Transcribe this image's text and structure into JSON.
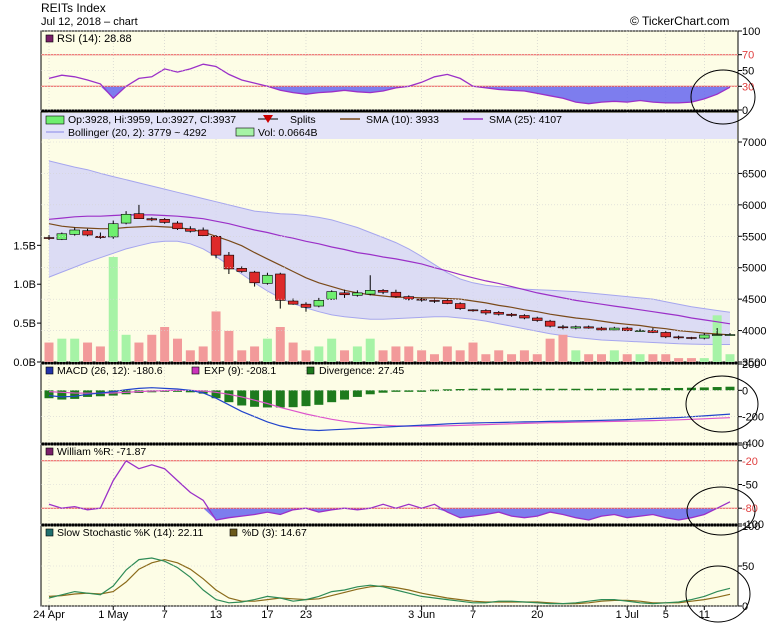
{
  "header": {
    "title": "REITs Index",
    "date": "Jul 12, 2018",
    "separator": "–",
    "chart_word": "chart",
    "watermark": "© TickerChart.com"
  },
  "colors": {
    "panel_bg": "#fdfde6",
    "rsi_line": "#9b30c8",
    "rsi_fill": "#6666ee",
    "ref_line": "#ee5555",
    "candle_up": "#6fef6f",
    "candle_down": "#dd2a2a",
    "sma10": "#7a4a1a",
    "sma25": "#9b30c8",
    "bollinger_line": "#a6a6ee",
    "bollinger_fill": "#d3d3f7",
    "vol_up": "#a6f3a6",
    "vol_down": "#f29a9a",
    "macd": "#2244cc",
    "exp": "#dd55cc",
    "divergence": "#1d7a1d",
    "william": "#9b30c8",
    "stoch_k": "#2e8b57",
    "stoch_d": "#8b6b1a"
  },
  "chart_data": {
    "type": "candlestick",
    "x_ticks": [
      {
        "i": 0,
        "label": "24 Apr"
      },
      {
        "i": 5,
        "label": "1 May"
      },
      {
        "i": 9,
        "label": "7"
      },
      {
        "i": 13,
        "label": "13"
      },
      {
        "i": 17,
        "label": "17"
      },
      {
        "i": 20,
        "label": "23"
      },
      {
        "i": 29,
        "label": "3 Jun"
      },
      {
        "i": 33,
        "label": "7"
      },
      {
        "i": 38,
        "label": "20"
      },
      {
        "i": 45,
        "label": "1 Jul"
      },
      {
        "i": 48,
        "label": "5"
      },
      {
        "i": 51,
        "label": "11"
      }
    ],
    "price": {
      "legend": {
        "ohlc": "Op:3928, Hi:3959, Lo:3927, Cl:3937",
        "splits": "Splits",
        "sma10": "SMA (10): 3933",
        "sma25": "SMA (25): 4107",
        "bollinger": "Bollinger (20, 2): 3779 ~ 4292",
        "volume": "Vol: 0.0664B"
      },
      "ylim": [
        3500,
        7000
      ],
      "y_ticks": [
        3500,
        4000,
        4500,
        5000,
        5500,
        6000,
        6500,
        7000
      ],
      "y_tick_labels": [
        "3500",
        "4000",
        "4500",
        "5000",
        "5500",
        "6000",
        "6500",
        "7000"
      ],
      "candles": [
        [
          5480,
          5520,
          5440,
          5470
        ],
        [
          5450,
          5560,
          5440,
          5540
        ],
        [
          5530,
          5640,
          5510,
          5600
        ],
        [
          5590,
          5620,
          5500,
          5520
        ],
        [
          5500,
          5560,
          5460,
          5480
        ],
        [
          5490,
          5750,
          5460,
          5700
        ],
        [
          5710,
          5900,
          5690,
          5850
        ],
        [
          5860,
          6000,
          5820,
          5780
        ],
        [
          5780,
          5800,
          5740,
          5760
        ],
        [
          5770,
          5790,
          5700,
          5720
        ],
        [
          5710,
          5740,
          5600,
          5620
        ],
        [
          5620,
          5660,
          5560,
          5580
        ],
        [
          5600,
          5640,
          5500,
          5510
        ],
        [
          5500,
          5520,
          5150,
          5200
        ],
        [
          5200,
          5250,
          4900,
          4980
        ],
        [
          4990,
          5020,
          4920,
          4940
        ],
        [
          4930,
          4950,
          4700,
          4760
        ],
        [
          4750,
          4920,
          4730,
          4880
        ],
        [
          4900,
          4920,
          4350,
          4480
        ],
        [
          4470,
          4510,
          4410,
          4420
        ],
        [
          4420,
          4450,
          4300,
          4370
        ],
        [
          4390,
          4520,
          4370,
          4480
        ],
        [
          4500,
          4640,
          4490,
          4620
        ],
        [
          4600,
          4650,
          4520,
          4570
        ],
        [
          4560,
          4640,
          4540,
          4600
        ],
        [
          4580,
          4880,
          4560,
          4640
        ],
        [
          4640,
          4660,
          4580,
          4610
        ],
        [
          4610,
          4650,
          4520,
          4540
        ],
        [
          4540,
          4560,
          4480,
          4500
        ],
        [
          4500,
          4520,
          4460,
          4490
        ],
        [
          4480,
          4510,
          4440,
          4470
        ],
        [
          4480,
          4500,
          4420,
          4430
        ],
        [
          4430,
          4450,
          4330,
          4350
        ],
        [
          4330,
          4340,
          4300,
          4320
        ],
        [
          4320,
          4340,
          4250,
          4280
        ],
        [
          4290,
          4310,
          4240,
          4260
        ],
        [
          4260,
          4280,
          4220,
          4240
        ],
        [
          4240,
          4260,
          4180,
          4200
        ],
        [
          4200,
          4220,
          4140,
          4160
        ],
        [
          4150,
          4170,
          4050,
          4070
        ],
        [
          4060,
          4090,
          4020,
          4050
        ],
        [
          4040,
          4080,
          4020,
          4060
        ],
        [
          4060,
          4080,
          4030,
          4040
        ],
        [
          4040,
          4060,
          4000,
          4010
        ],
        [
          4010,
          4060,
          4000,
          4040
        ],
        [
          4040,
          4060,
          3990,
          4000
        ],
        [
          4000,
          4030,
          3980,
          4000
        ],
        [
          4000,
          4040,
          3960,
          3970
        ],
        [
          3970,
          3990,
          3880,
          3900
        ],
        [
          3900,
          3920,
          3860,
          3890
        ],
        [
          3890,
          3900,
          3860,
          3880
        ],
        [
          3880,
          3960,
          3860,
          3930
        ],
        [
          3928,
          4040,
          3927,
          3937
        ],
        [
          3937,
          3959,
          3927,
          3937
        ]
      ],
      "sma10": [
        5700,
        5660,
        5640,
        5630,
        5620,
        5620,
        5640,
        5650,
        5660,
        5650,
        5640,
        5610,
        5570,
        5500,
        5430,
        5350,
        5240,
        5140,
        5040,
        4940,
        4840,
        4760,
        4700,
        4640,
        4600,
        4570,
        4550,
        4530,
        4530,
        4520,
        4520,
        4510,
        4500,
        4470,
        4440,
        4400,
        4370,
        4330,
        4300,
        4260,
        4230,
        4200,
        4180,
        4150,
        4120,
        4100,
        4080,
        4050,
        4030,
        4000,
        3980,
        3960,
        3945,
        3933
      ],
      "sma25": [
        5770,
        5790,
        5810,
        5820,
        5820,
        5830,
        5840,
        5840,
        5840,
        5830,
        5820,
        5800,
        5780,
        5740,
        5700,
        5650,
        5600,
        5560,
        5510,
        5470,
        5420,
        5380,
        5330,
        5290,
        5240,
        5210,
        5170,
        5140,
        5100,
        5060,
        5000,
        4950,
        4890,
        4840,
        4790,
        4750,
        4700,
        4650,
        4600,
        4560,
        4520,
        4480,
        4450,
        4420,
        4390,
        4360,
        4330,
        4300,
        4270,
        4240,
        4200,
        4170,
        4140,
        4107
      ],
      "bollinger_upper": [
        6700,
        6650,
        6600,
        6560,
        6500,
        6450,
        6400,
        6350,
        6300,
        6250,
        6200,
        6150,
        6100,
        6050,
        6000,
        5950,
        5900,
        5880,
        5860,
        5850,
        5830,
        5800,
        5760,
        5700,
        5640,
        5560,
        5480,
        5400,
        5300,
        5180,
        5050,
        4920,
        4820,
        4760,
        4720,
        4700,
        4680,
        4660,
        4650,
        4640,
        4630,
        4620,
        4600,
        4580,
        4560,
        4540,
        4520,
        4500,
        4460,
        4420,
        4380,
        4350,
        4320,
        4292
      ],
      "bollinger_lower": [
        4850,
        4930,
        5010,
        5090,
        5160,
        5230,
        5300,
        5350,
        5400,
        5420,
        5420,
        5380,
        5300,
        5180,
        5040,
        4900,
        4760,
        4630,
        4520,
        4430,
        4360,
        4300,
        4250,
        4220,
        4200,
        4180,
        4180,
        4190,
        4200,
        4210,
        4220,
        4220,
        4200,
        4180,
        4150,
        4110,
        4070,
        4030,
        3990,
        3950,
        3920,
        3890,
        3870,
        3850,
        3840,
        3830,
        3820,
        3810,
        3800,
        3790,
        3785,
        3780,
        3779,
        3779
      ],
      "volume_ylim": [
        0,
        1.8
      ],
      "volume_ticks": [
        0.0,
        0.5,
        1.0,
        1.5
      ],
      "volume_tick_labels": [
        "0.0B",
        "0.5B",
        "1.0B",
        "1.5B"
      ],
      "volume": [
        0.25,
        0.3,
        0.3,
        0.25,
        0.2,
        1.35,
        0.35,
        0.25,
        0.35,
        0.45,
        0.3,
        0.15,
        0.2,
        0.65,
        0.4,
        0.15,
        0.2,
        0.3,
        0.45,
        0.25,
        0.15,
        0.2,
        0.3,
        0.15,
        0.2,
        0.3,
        0.15,
        0.2,
        0.2,
        0.15,
        0.1,
        0.2,
        0.15,
        0.25,
        0.1,
        0.15,
        0.1,
        0.15,
        0.1,
        0.3,
        0.35,
        0.15,
        0.1,
        0.1,
        0.15,
        0.1,
        0.1,
        0.1,
        0.1,
        0.05,
        0.05,
        0.05,
        0.6,
        0.1
      ]
    },
    "rsi": {
      "legend": "RSI (14): 28.88",
      "ylim": [
        0,
        100
      ],
      "y_ticks": [
        0,
        30,
        50,
        70,
        100
      ],
      "y_tick_labels": [
        "0",
        "30",
        "50",
        "70",
        "100"
      ],
      "ref_levels": [
        70,
        30
      ],
      "values": [
        40,
        44,
        42,
        38,
        33,
        15,
        30,
        40,
        42,
        52,
        48,
        52,
        58,
        55,
        45,
        38,
        34,
        30,
        25,
        22,
        20,
        22,
        23,
        25,
        23,
        22,
        24,
        28,
        30,
        35,
        42,
        45,
        40,
        30,
        28,
        26,
        25,
        24,
        21,
        18,
        15,
        10,
        8,
        10,
        11,
        10,
        12,
        10,
        9,
        9,
        10,
        14,
        20,
        28.88
      ]
    },
    "macd": {
      "legend_macd": "MACD (26, 12): -180.6",
      "legend_exp": "EXP (9): -208.1",
      "legend_div": "Divergence: 27.45",
      "ylim": [
        -400,
        200
      ],
      "y_ticks": [
        -400,
        -200,
        0,
        200
      ],
      "y_tick_labels": [
        "-400",
        "-200",
        "0",
        "200"
      ],
      "macd": [
        -40,
        -50,
        -45,
        -30,
        -20,
        -10,
        5,
        15,
        20,
        15,
        10,
        0,
        -20,
        -60,
        -110,
        -160,
        -200,
        -240,
        -270,
        -290,
        -300,
        -305,
        -300,
        -295,
        -290,
        -285,
        -280,
        -275,
        -270,
        -265,
        -260,
        -255,
        -250,
        -248,
        -246,
        -244,
        -242,
        -240,
        -238,
        -236,
        -234,
        -232,
        -230,
        -228,
        -225,
        -222,
        -218,
        -214,
        -210,
        -206,
        -200,
        -194,
        -187,
        -180.6
      ],
      "exp": [
        -10,
        -15,
        -20,
        -22,
        -22,
        -20,
        -15,
        -10,
        -5,
        -2,
        0,
        0,
        -5,
        -15,
        -30,
        -50,
        -75,
        -100,
        -130,
        -155,
        -180,
        -200,
        -220,
        -235,
        -248,
        -258,
        -265,
        -270,
        -272,
        -272,
        -271,
        -269,
        -266,
        -263,
        -260,
        -257,
        -254,
        -251,
        -248,
        -246,
        -244,
        -242,
        -240,
        -238,
        -236,
        -234,
        -232,
        -230,
        -227,
        -224,
        -220,
        -216,
        -212,
        -208.1
      ],
      "divergence": [
        -60,
        -70,
        -65,
        -50,
        -45,
        -40,
        -30,
        -20,
        -15,
        -10,
        -10,
        -15,
        -25,
        -60,
        -90,
        -115,
        -125,
        -130,
        -130,
        -128,
        -120,
        -110,
        -90,
        -70,
        -50,
        -30,
        -18,
        -8,
        -2,
        0,
        5,
        8,
        10,
        12,
        13,
        14,
        14,
        13,
        12,
        12,
        12,
        12,
        12,
        12,
        13,
        14,
        15,
        16,
        17,
        18,
        20,
        22,
        25,
        27.45
      ]
    },
    "william": {
      "legend": "William %R: -71.87",
      "ylim": [
        -100,
        0
      ],
      "y_ticks": [
        -100,
        -80,
        -50,
        -20,
        0
      ],
      "y_tick_labels": [
        "-100",
        "-80",
        "-50",
        "-20",
        "0"
      ],
      "ref_levels": [
        -20,
        -80
      ],
      "values": [
        -75,
        -80,
        -78,
        -82,
        -80,
        -45,
        -20,
        -30,
        -25,
        -30,
        -45,
        -60,
        -70,
        -95,
        -92,
        -90,
        -88,
        -85,
        -88,
        -82,
        -80,
        -85,
        -82,
        -80,
        -82,
        -80,
        -75,
        -80,
        -75,
        -80,
        -75,
        -85,
        -92,
        -90,
        -88,
        -85,
        -90,
        -92,
        -90,
        -85,
        -88,
        -92,
        -95,
        -90,
        -88,
        -92,
        -90,
        -88,
        -92,
        -95,
        -92,
        -88,
        -80,
        -71.87
      ]
    },
    "stochastic": {
      "legend_k": "Slow Stochastic %K (14): 22.11",
      "legend_d": "%D (3): 14.67",
      "ylim": [
        0,
        100
      ],
      "y_ticks": [
        0,
        50,
        100
      ],
      "y_tick_labels": [
        "0",
        "50",
        "100"
      ],
      "k": [
        10,
        14,
        18,
        16,
        14,
        25,
        45,
        58,
        60,
        56,
        48,
        36,
        20,
        8,
        4,
        5,
        8,
        12,
        10,
        6,
        8,
        12,
        18,
        20,
        24,
        26,
        24,
        20,
        16,
        12,
        10,
        8,
        6,
        4,
        4,
        6,
        6,
        5,
        4,
        3,
        3,
        4,
        6,
        8,
        8,
        6,
        4,
        3,
        4,
        5,
        8,
        12,
        18,
        22.11
      ],
      "d": [
        12,
        13,
        15,
        16,
        15,
        18,
        30,
        46,
        54,
        58,
        54,
        46,
        34,
        20,
        10,
        6,
        6,
        8,
        10,
        9,
        8,
        9,
        13,
        17,
        21,
        24,
        25,
        23,
        20,
        16,
        13,
        10,
        8,
        6,
        5,
        5,
        5,
        5,
        5,
        4,
        3,
        3,
        4,
        6,
        7,
        7,
        6,
        4,
        4,
        4,
        6,
        8,
        11,
        14.67
      ]
    }
  }
}
